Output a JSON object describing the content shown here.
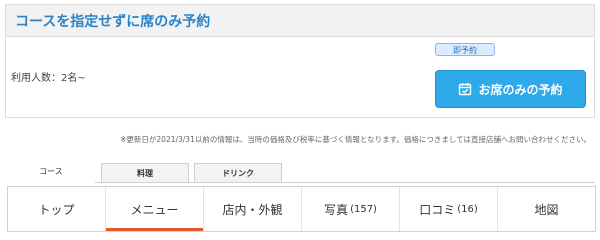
{
  "course_card": {
    "title": "コースを指定せずに席のみ予約",
    "capacity": "利用人数：2名~",
    "badge": "即予約",
    "button_label": "お席のみの予約",
    "accent_color": "#2a83c8",
    "button_color": "#2ea9e9"
  },
  "notice": "※更新日が2021/3/31以前の情報は、当時の価格及び税率に基づく情報となります。価格につきましては直接店舗へお問い合わせください。",
  "sub_tabs": [
    {
      "label": "コース",
      "active": true
    },
    {
      "label": "料理",
      "active": false
    },
    {
      "label": "ドリンク",
      "active": false
    }
  ],
  "nav": {
    "items": [
      {
        "label": "トップ",
        "count": ""
      },
      {
        "label": "メニュー",
        "count": "",
        "active": true
      },
      {
        "label": "店内・外観",
        "count": ""
      },
      {
        "label": "写真",
        "count": "(157)"
      },
      {
        "label": "口コミ",
        "count": "(16)"
      },
      {
        "label": "地図",
        "count": ""
      }
    ],
    "active_color": "#e05a2b"
  }
}
